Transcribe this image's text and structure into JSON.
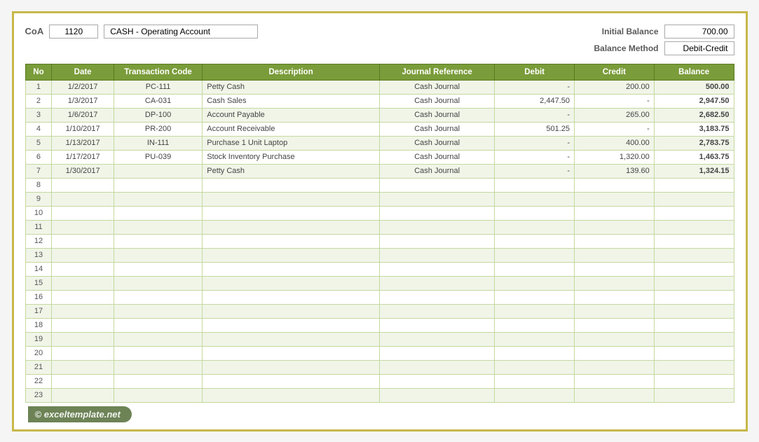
{
  "header": {
    "coa_label": "CoA",
    "coa_code": "1120",
    "coa_description": "CASH - Operating Account",
    "initial_balance_label": "Initial Balance",
    "initial_balance_value": "700.00",
    "balance_method_label": "Balance Method",
    "balance_method_value": "Debit-Credit"
  },
  "table": {
    "columns": [
      "No",
      "Date",
      "Transaction Code",
      "Description",
      "Journal Reference",
      "Debit",
      "Credit",
      "Balance"
    ],
    "rows": [
      {
        "no": "1",
        "date": "1/2/2017",
        "txcode": "PC-111",
        "desc": "Petty Cash",
        "jref": "Cash Journal",
        "debit": "-",
        "credit": "200.00",
        "balance": "500.00"
      },
      {
        "no": "2",
        "date": "1/3/2017",
        "txcode": "CA-031",
        "desc": "Cash Sales",
        "jref": "Cash Journal",
        "debit": "2,447.50",
        "credit": "-",
        "balance": "2,947.50"
      },
      {
        "no": "3",
        "date": "1/6/2017",
        "txcode": "DP-100",
        "desc": "Account Payable",
        "jref": "Cash Journal",
        "debit": "-",
        "credit": "265.00",
        "balance": "2,682.50"
      },
      {
        "no": "4",
        "date": "1/10/2017",
        "txcode": "PR-200",
        "desc": "Account Receivable",
        "jref": "Cash Journal",
        "debit": "501.25",
        "credit": "-",
        "balance": "3,183.75"
      },
      {
        "no": "5",
        "date": "1/13/2017",
        "txcode": "IN-111",
        "desc": "Purchase 1 Unit Laptop",
        "jref": "Cash Journal",
        "debit": "-",
        "credit": "400.00",
        "balance": "2,783.75"
      },
      {
        "no": "6",
        "date": "1/17/2017",
        "txcode": "PU-039",
        "desc": "Stock Inventory Purchase",
        "jref": "Cash Journal",
        "debit": "-",
        "credit": "1,320.00",
        "balance": "1,463.75"
      },
      {
        "no": "7",
        "date": "1/30/2017",
        "txcode": "",
        "desc": "Petty Cash",
        "jref": "Cash Journal",
        "debit": "-",
        "credit": "139.60",
        "balance": "1,324.15"
      },
      {
        "no": "8",
        "date": "",
        "txcode": "",
        "desc": "",
        "jref": "",
        "debit": "",
        "credit": "",
        "balance": ""
      },
      {
        "no": "9",
        "date": "",
        "txcode": "",
        "desc": "",
        "jref": "",
        "debit": "",
        "credit": "",
        "balance": ""
      },
      {
        "no": "10",
        "date": "",
        "txcode": "",
        "desc": "",
        "jref": "",
        "debit": "",
        "credit": "",
        "balance": ""
      },
      {
        "no": "11",
        "date": "",
        "txcode": "",
        "desc": "",
        "jref": "",
        "debit": "",
        "credit": "",
        "balance": ""
      },
      {
        "no": "12",
        "date": "",
        "txcode": "",
        "desc": "",
        "jref": "",
        "debit": "",
        "credit": "",
        "balance": ""
      },
      {
        "no": "13",
        "date": "",
        "txcode": "",
        "desc": "",
        "jref": "",
        "debit": "",
        "credit": "",
        "balance": ""
      },
      {
        "no": "14",
        "date": "",
        "txcode": "",
        "desc": "",
        "jref": "",
        "debit": "",
        "credit": "",
        "balance": ""
      },
      {
        "no": "15",
        "date": "",
        "txcode": "",
        "desc": "",
        "jref": "",
        "debit": "",
        "credit": "",
        "balance": ""
      },
      {
        "no": "16",
        "date": "",
        "txcode": "",
        "desc": "",
        "jref": "",
        "debit": "",
        "credit": "",
        "balance": ""
      },
      {
        "no": "17",
        "date": "",
        "txcode": "",
        "desc": "",
        "jref": "",
        "debit": "",
        "credit": "",
        "balance": ""
      },
      {
        "no": "18",
        "date": "",
        "txcode": "",
        "desc": "",
        "jref": "",
        "debit": "",
        "credit": "",
        "balance": ""
      },
      {
        "no": "19",
        "date": "",
        "txcode": "",
        "desc": "",
        "jref": "",
        "debit": "",
        "credit": "",
        "balance": ""
      },
      {
        "no": "20",
        "date": "",
        "txcode": "",
        "desc": "",
        "jref": "",
        "debit": "",
        "credit": "",
        "balance": ""
      },
      {
        "no": "21",
        "date": "",
        "txcode": "",
        "desc": "",
        "jref": "",
        "debit": "",
        "credit": "",
        "balance": ""
      },
      {
        "no": "22",
        "date": "",
        "txcode": "",
        "desc": "",
        "jref": "",
        "debit": "",
        "credit": "",
        "balance": ""
      },
      {
        "no": "23",
        "date": "",
        "txcode": "",
        "desc": "",
        "jref": "",
        "debit": "",
        "credit": "",
        "balance": ""
      }
    ]
  },
  "watermark": {
    "symbol": "©",
    "text": "exceltemplate.net"
  }
}
